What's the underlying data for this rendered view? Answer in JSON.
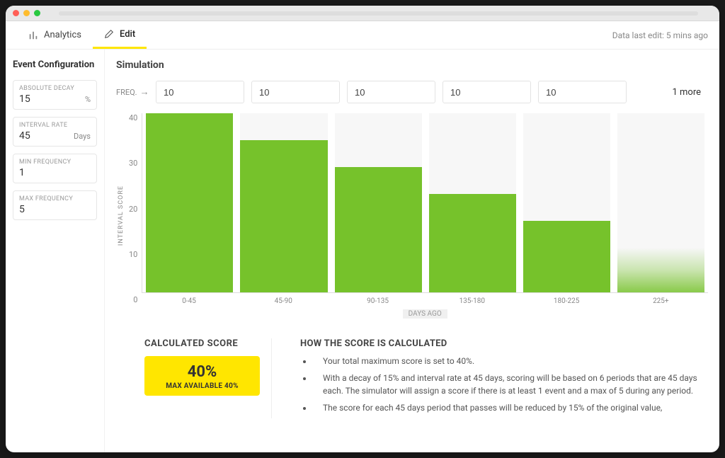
{
  "tabs": {
    "analytics": "Analytics",
    "edit": "Edit"
  },
  "status_text": "Data last edit: 5 mins ago",
  "sidebar": {
    "title": "Event Configuration",
    "absolute_decay_label": "ABSOLUTE DECAY",
    "absolute_decay_value": "15",
    "absolute_decay_unit": "%",
    "interval_rate_label": "INTERVAL RATE",
    "interval_rate_value": "45",
    "interval_rate_unit": "Days",
    "min_freq_label": "MIN FREQUENCY",
    "min_freq_value": "1",
    "max_freq_label": "MAX FREQUENCY",
    "max_freq_value": "5"
  },
  "simulation": {
    "title": "Simulation",
    "freq_label": "FREQ.",
    "freq_values": [
      "10",
      "10",
      "10",
      "10",
      "10"
    ],
    "more_text": "1 more"
  },
  "chart_data": {
    "type": "bar",
    "title": "",
    "ylabel": "INTERVAL SCORE",
    "xlabel": "DAYS AGO",
    "ylim": [
      0,
      40
    ],
    "y_ticks": [
      "40",
      "30",
      "20",
      "10",
      "0"
    ],
    "categories": [
      "0-45",
      "45-90",
      "90-135",
      "135-180",
      "180-225",
      "225+"
    ],
    "values": [
      40,
      34,
      28,
      22,
      16,
      10
    ],
    "last_faded": true
  },
  "footer": {
    "calc_title": "CALCULATED SCORE",
    "calc_pct": "40%",
    "calc_sub": "MAX AVAILABLE 40%",
    "how_title": "HOW THE SCORE IS CALCULATED",
    "bullets": [
      "Your total maximum score is set to 40%.",
      "With a decay of 15% and interval rate at 45 days, scoring will be based on 6 periods that are 45 days each. The simulator will assign a score if there is at least 1 event and a max of 5 during any period.",
      "The score for each 45 days period that passes will be reduced by 15% of the original value,"
    ]
  }
}
